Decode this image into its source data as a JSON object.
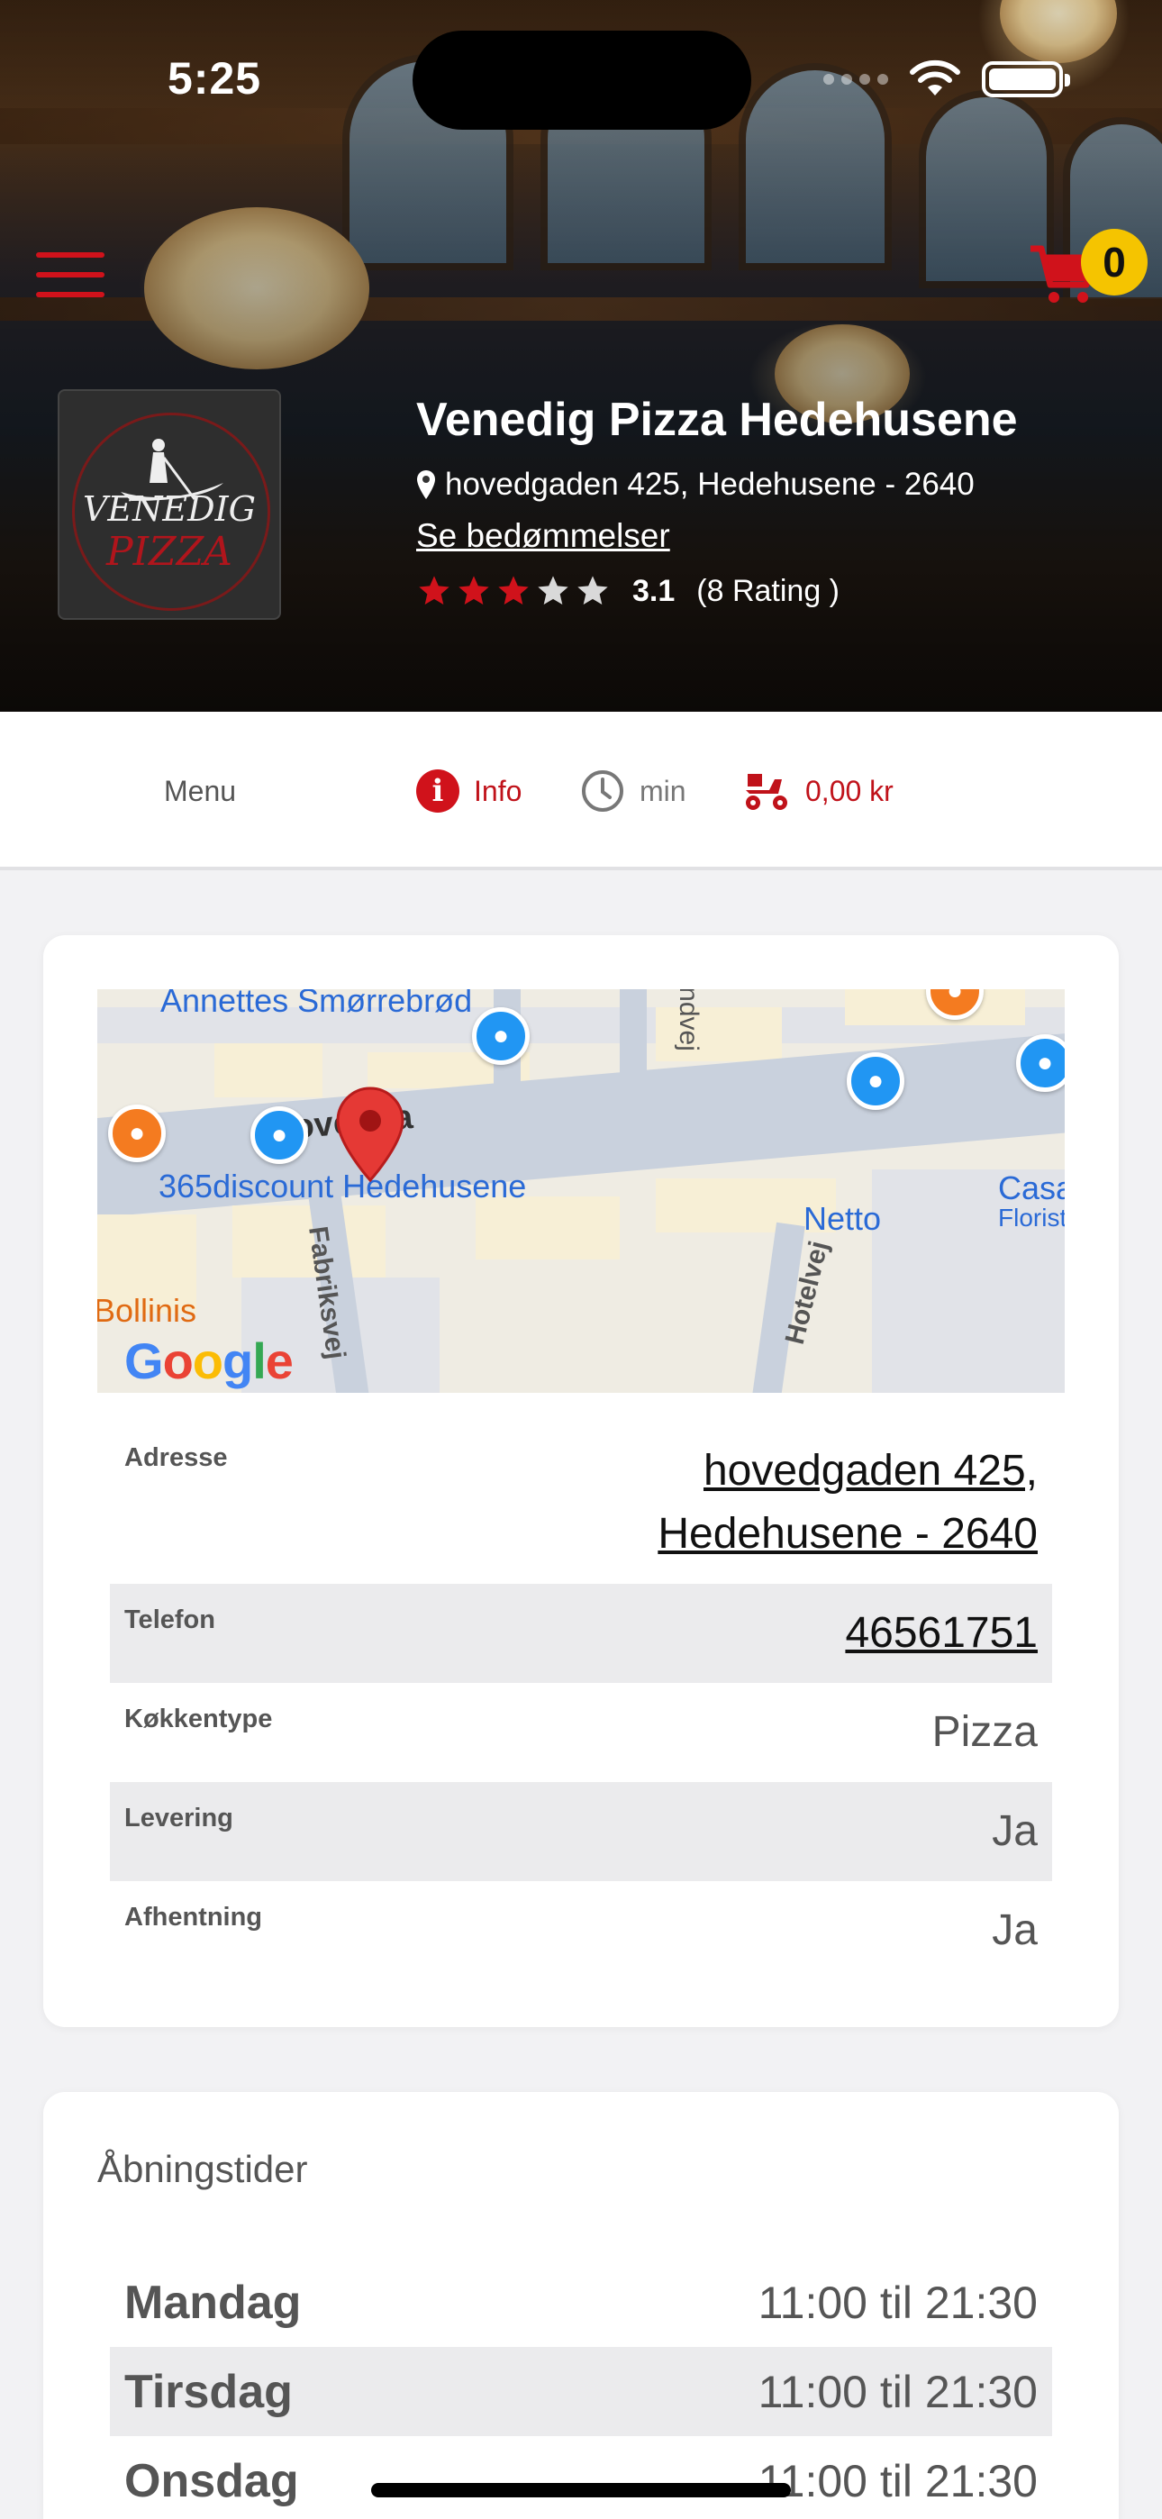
{
  "status_bar": {
    "time": "5:25"
  },
  "header": {
    "cart_count": "0",
    "logo": {
      "top": "VENEDIG",
      "bottom": "PIZZA"
    },
    "restaurant_name": "Venedig Pizza Hedehusene",
    "address": "hovedgaden 425, Hedehusene - 2640",
    "reviews_link": "Se bedømmelser",
    "rating_value": "3.1",
    "rating_count": "(8 Rating )",
    "rating_stars": 3.1,
    "rating_max": 5
  },
  "tabs": {
    "menu": "Menu",
    "info": "Info",
    "time": "min",
    "fee": "0,00 kr"
  },
  "map": {
    "labels": {
      "annettes": "Annettes Smørrebrød",
      "hovedgaden": "Hovedga",
      "discount": "365discount Hedehusene",
      "netto": "Netto",
      "casa": "Casa",
      "florist": "Florist",
      "bollinis": "Bollinis",
      "fabriksvej": "Fabriksvej",
      "hotelvej": "Hotelvej",
      "andvej": "ndvej"
    },
    "google": "Google"
  },
  "info_table": {
    "address_label": "Adresse",
    "address_line1": "hovedgaden 425,",
    "address_line2": "Hedehusene - 2640",
    "phone_label": "Telefon",
    "phone_value": "46561751",
    "cuisine_label": "Køkkentype",
    "cuisine_value": "Pizza",
    "delivery_label": "Levering",
    "delivery_value": "Ja",
    "pickup_label": "Afhentning",
    "pickup_value": "Ja"
  },
  "hours": {
    "title": "Åbningstider",
    "rows": [
      {
        "day": "Mandag",
        "time": "11:00 til 21:30"
      },
      {
        "day": "Tirsdag",
        "time": "11:00 til 21:30"
      },
      {
        "day": "Onsdag",
        "time": "11:00 til 21:30"
      }
    ]
  },
  "colors": {
    "accent_red": "#d0121b",
    "badge_yellow": "#f5c400",
    "star_gray": "#d9d9d9"
  }
}
